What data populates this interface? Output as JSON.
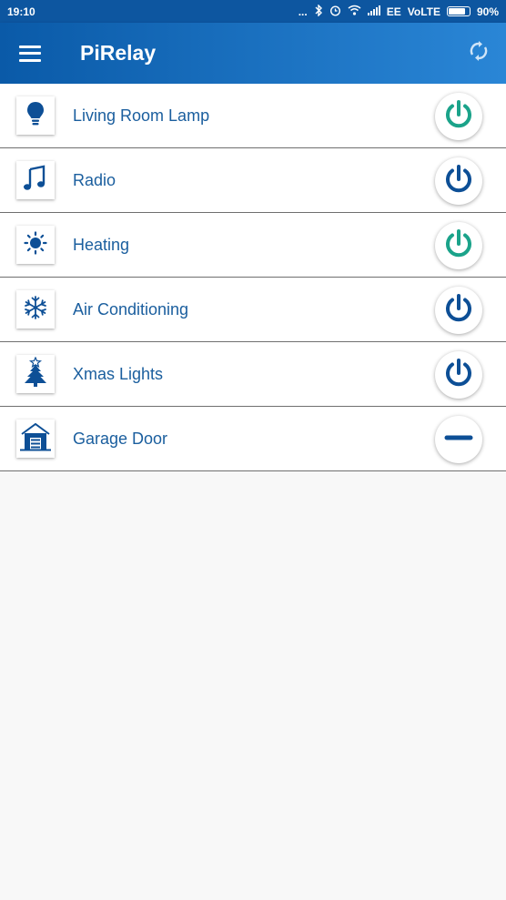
{
  "status_bar": {
    "time": "19:10",
    "dots": "...",
    "carrier": "EE",
    "network": "VoLTE",
    "battery": "90%",
    "battery_level": 0.9
  },
  "app_bar": {
    "title": "PiRelay",
    "menu_icon": "hamburger-menu-icon",
    "refresh_icon": "refresh-icon",
    "color_start": "#0a5aa8",
    "color_end": "#2a86d6"
  },
  "colors": {
    "on": "#1ba38a",
    "off": "#0d4f96",
    "label": "#1a5e9e"
  },
  "relays": [
    {
      "label": "Living Room Lamp",
      "icon": "lightbulb-icon",
      "state": "on"
    },
    {
      "label": "Radio",
      "icon": "music-note-icon",
      "state": "off"
    },
    {
      "label": "Heating",
      "icon": "sun-icon",
      "state": "on"
    },
    {
      "label": "Air Conditioning",
      "icon": "snowflake-icon",
      "state": "off"
    },
    {
      "label": "Xmas Lights",
      "icon": "christmas-tree-icon",
      "state": "off"
    },
    {
      "label": "Garage Door",
      "icon": "garage-icon",
      "state": "momentary"
    }
  ]
}
